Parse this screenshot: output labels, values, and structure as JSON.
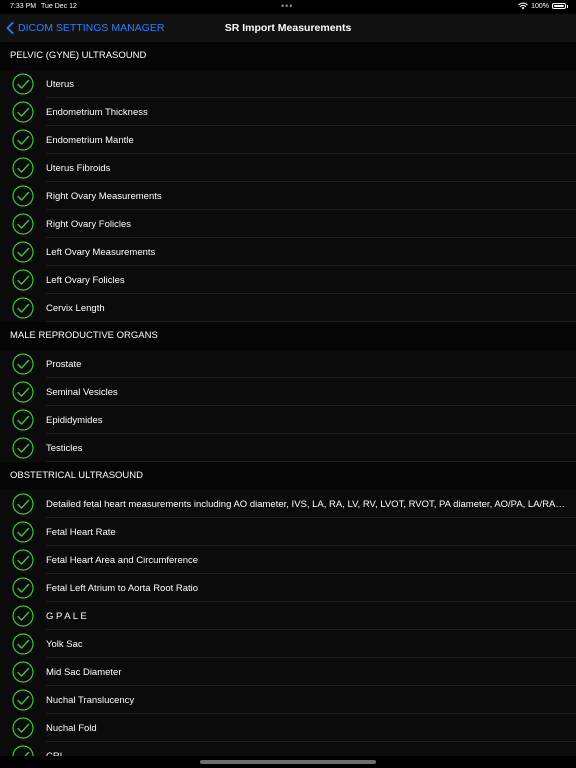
{
  "status_bar": {
    "time": "7:33 PM",
    "date": "Tue Dec 12",
    "dots": "•••",
    "battery_pct": "100%",
    "icons": [
      "wifi-icon",
      "battery-icon"
    ]
  },
  "nav": {
    "back_label": "DICOM SETTINGS MANAGER",
    "title": "SR Import Measurements",
    "back_icon": "chevron-left-icon"
  },
  "colors": {
    "accent": "#2f7cf6",
    "check": "#3fc43a",
    "background": "#000000"
  },
  "sections": [
    {
      "header": "PELVIC (GYNE) ULTRASOUND",
      "items": [
        {
          "label": "Uterus",
          "checked": true
        },
        {
          "label": "Endometrium Thickness",
          "checked": true
        },
        {
          "label": "Endometrium Mantle",
          "checked": true
        },
        {
          "label": "Uterus Fibroids",
          "checked": true
        },
        {
          "label": "Right Ovary Measurements",
          "checked": true
        },
        {
          "label": "Right Ovary Folicles",
          "checked": true
        },
        {
          "label": "Left Ovary Measurements",
          "checked": true
        },
        {
          "label": "Left Ovary Folicles",
          "checked": true
        },
        {
          "label": "Cervix Length",
          "checked": true
        }
      ]
    },
    {
      "header": "MALE REPRODUCTIVE ORGANS",
      "items": [
        {
          "label": "Prostate",
          "checked": true
        },
        {
          "label": "Seminal Vesicles",
          "checked": true
        },
        {
          "label": "Epididymides",
          "checked": true
        },
        {
          "label": "Testicles",
          "checked": true
        }
      ]
    },
    {
      "header": "OBSTETRICAL ULTRASOUND",
      "items": [
        {
          "label": "Detailed fetal heart measurements including AO diameter, IVS, LA, RA, LV, RV, LVOT, RVOT, PA diameter, AO/PA, LA/RA, L...",
          "checked": true
        },
        {
          "label": "Fetal Heart Rate",
          "checked": true
        },
        {
          "label": "Fetal Heart Area and Circumference",
          "checked": true
        },
        {
          "label": "Fetal Left Atrium to Aorta Root Ratio",
          "checked": true
        },
        {
          "label": "G P A L E",
          "checked": true
        },
        {
          "label": "Yolk Sac",
          "checked": true
        },
        {
          "label": "Mid Sac Diameter",
          "checked": true
        },
        {
          "label": "Nuchal Translucency",
          "checked": true
        },
        {
          "label": "Nuchal Fold",
          "checked": true
        },
        {
          "label": "CRL",
          "checked": true
        }
      ]
    }
  ]
}
